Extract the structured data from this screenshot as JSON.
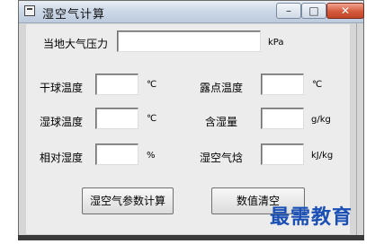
{
  "window": {
    "title": "湿空气计算",
    "controls": {
      "minimize": "–",
      "maximize": "□",
      "close": "✕"
    }
  },
  "form": {
    "pressure_label": "当地大气压力",
    "pressure_value": "",
    "pressure_unit": "kPa",
    "dry_bulb_label": "干球温度",
    "dry_bulb_value": "",
    "dry_bulb_unit": "℃",
    "dew_point_label": "露点温度",
    "dew_point_value": "",
    "dew_point_unit": "℃",
    "wet_bulb_label": "湿球温度",
    "wet_bulb_value": "",
    "wet_bulb_unit": "℃",
    "moisture_label": "含湿量",
    "moisture_value": "",
    "moisture_unit": "g/kg",
    "rh_label": "相对湿度",
    "rh_value": "",
    "rh_unit": "%",
    "enthalpy_label": "湿空气焓",
    "enthalpy_value": "",
    "enthalpy_unit": "kJ/kg"
  },
  "buttons": {
    "calculate": "湿空气参数计算",
    "clear": "数值清空"
  },
  "watermark": "最需教育"
}
